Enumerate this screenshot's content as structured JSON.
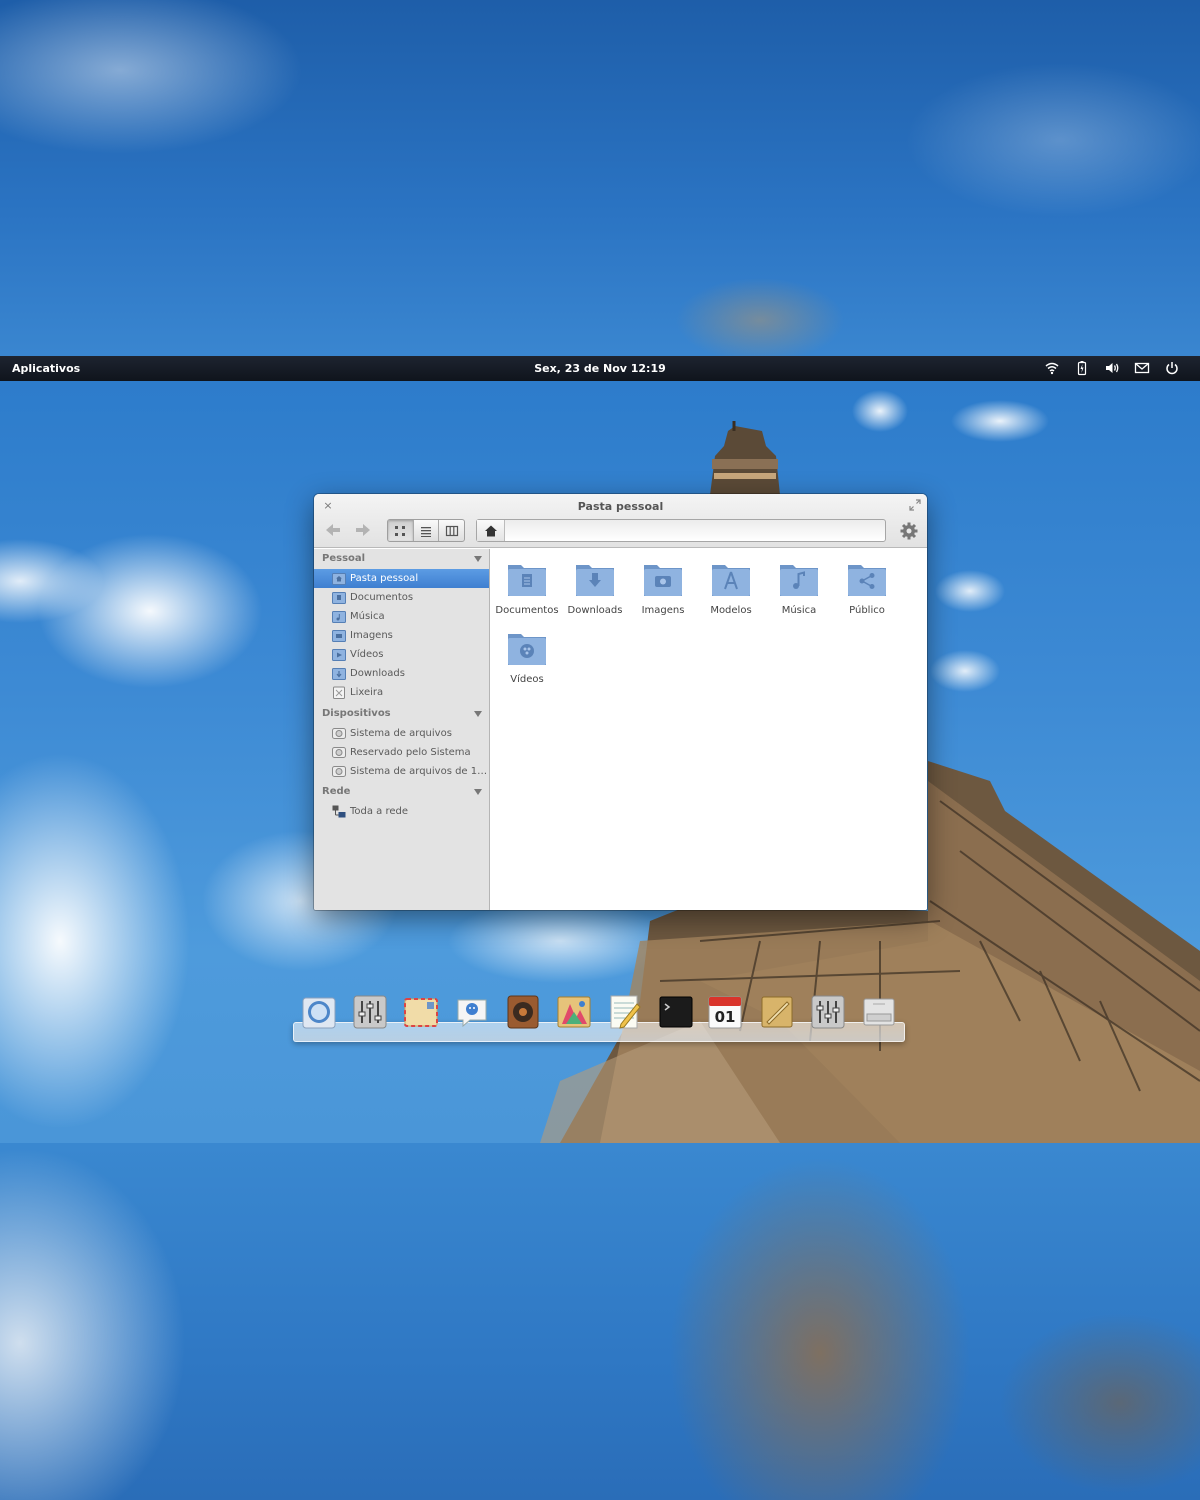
{
  "panel": {
    "apps_label": "Aplicativos",
    "clock": "Sex, 23 de Nov 12:19",
    "tray": [
      "wifi-icon",
      "battery-icon",
      "volume-icon",
      "mail-icon",
      "power-icon"
    ]
  },
  "window": {
    "title": "Pasta pessoal",
    "close_glyph": "×",
    "view_modes": [
      "grid-view-icon",
      "list-view-icon",
      "columns-view-icon"
    ],
    "active_view": "grid-view-icon"
  },
  "sidebar": {
    "sections": [
      {
        "heading": "Pessoal",
        "items": [
          {
            "label": "Pasta pessoal",
            "icon": "home-folder-icon",
            "selected": true
          },
          {
            "label": "Documentos",
            "icon": "documents-folder-icon"
          },
          {
            "label": "Música",
            "icon": "music-folder-icon"
          },
          {
            "label": "Imagens",
            "icon": "pictures-folder-icon"
          },
          {
            "label": "Vídeos",
            "icon": "videos-folder-icon"
          },
          {
            "label": "Downloads",
            "icon": "downloads-folder-icon"
          },
          {
            "label": "Lixeira",
            "icon": "trash-icon"
          }
        ]
      },
      {
        "heading": "Dispositivos",
        "items": [
          {
            "label": "Sistema de arquivos",
            "icon": "drive-icon"
          },
          {
            "label": "Reservado pelo Sistema",
            "icon": "drive-icon"
          },
          {
            "label": "Sistema de arquivos de 11...",
            "icon": "drive-icon"
          }
        ]
      },
      {
        "heading": "Rede",
        "items": [
          {
            "label": "Toda a rede",
            "icon": "network-icon"
          }
        ]
      }
    ]
  },
  "files": [
    {
      "name": "Documentos",
      "icon": "documents-folder-icon"
    },
    {
      "name": "Downloads",
      "icon": "downloads-folder-icon"
    },
    {
      "name": "Imagens",
      "icon": "pictures-folder-icon"
    },
    {
      "name": "Modelos",
      "icon": "templates-folder-icon"
    },
    {
      "name": "Música",
      "icon": "music-folder-icon"
    },
    {
      "name": "Público",
      "icon": "public-folder-icon"
    },
    {
      "name": "Vídeos",
      "icon": "videos-folder-icon"
    }
  ],
  "dock": {
    "apps": [
      "browser-icon",
      "equalizer-icon",
      "mail-app-icon",
      "chat-icon",
      "music-player-icon",
      "photos-icon",
      "text-editor-icon",
      "terminal-icon",
      "calendar-icon",
      "notes-icon",
      "settings-icon",
      "disk-utility-icon"
    ],
    "calendar_day": "01"
  },
  "colors": {
    "selection": "#4a8ad8",
    "folder": "#7ea6d8",
    "panel": "#141a23"
  }
}
